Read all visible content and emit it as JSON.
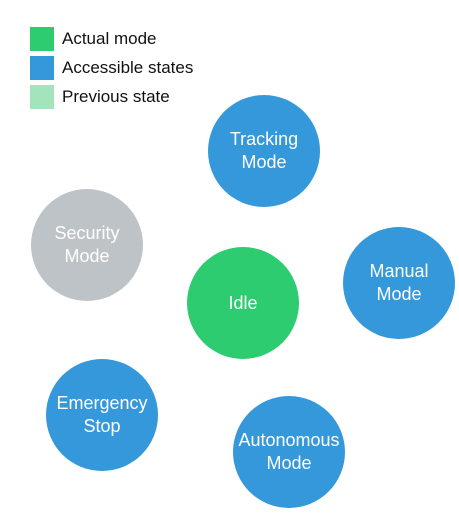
{
  "colors": {
    "actual": "#2ecc71",
    "accessible": "#3498db",
    "previous": "#a3e4bd",
    "inactive": "#bdc3c7"
  },
  "legend": [
    {
      "label": "Actual mode",
      "color": "#2ecc71"
    },
    {
      "label": "Accessible states",
      "color": "#3498db"
    },
    {
      "label": "Previous state",
      "color": "#a3e4bd"
    }
  ],
  "nodes": {
    "idle": {
      "label": "Idle",
      "color": "#2ecc71"
    },
    "tracking": {
      "label": "Tracking\nMode",
      "color": "#3498db"
    },
    "manual": {
      "label": "Manual\nMode",
      "color": "#3498db"
    },
    "autonomous": {
      "label": "Autonomous\nMode",
      "color": "#3498db"
    },
    "emergency": {
      "label": "Emergency\nStop",
      "color": "#3498db"
    },
    "security": {
      "label": "Security\nMode",
      "color": "#bdc3c7"
    }
  }
}
